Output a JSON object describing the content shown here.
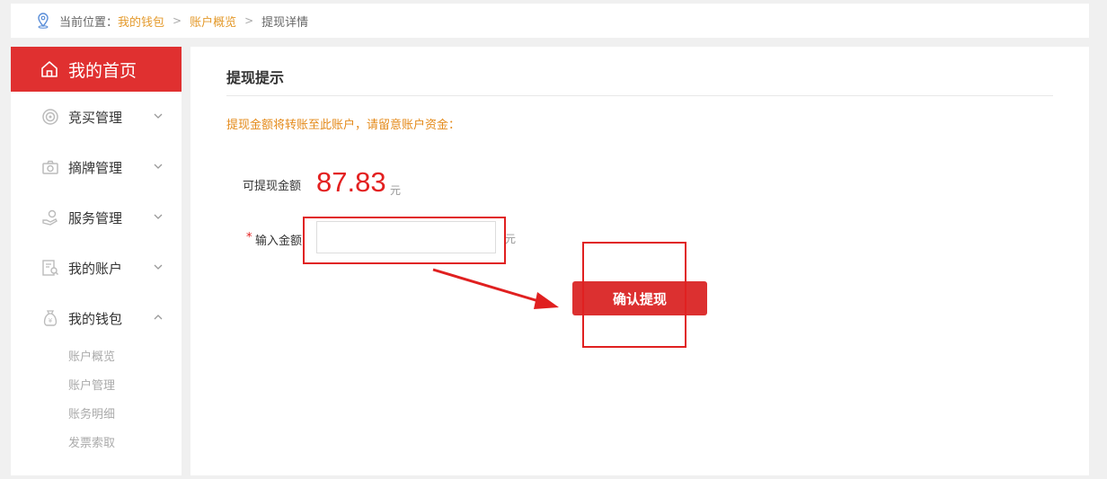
{
  "breadcrumb": {
    "prefix": "当前位置：",
    "items": [
      "我的钱包",
      "账户概览"
    ],
    "current": "提现详情"
  },
  "sidebar": {
    "home_label": "我的首页",
    "items": [
      {
        "label": "竞买管理",
        "icon": "target-icon",
        "expanded": false
      },
      {
        "label": "摘牌管理",
        "icon": "camera-icon",
        "expanded": false
      },
      {
        "label": "服务管理",
        "icon": "hand-icon",
        "expanded": false
      },
      {
        "label": "我的账户",
        "icon": "account-icon",
        "expanded": false
      },
      {
        "label": "我的钱包",
        "icon": "money-bag-icon",
        "expanded": true
      }
    ],
    "wallet_subitems": [
      "账户概览",
      "账户管理",
      "账务明细",
      "发票索取"
    ]
  },
  "main": {
    "section_title": "提现提示",
    "notice": "提现金额将转账至此账户，请留意账户资金：",
    "balance_label": "可提现金额",
    "balance_value": "87.83",
    "balance_unit": "元",
    "required_mark": "*",
    "amount_label": "输入金额",
    "amount_value": "",
    "amount_unit": "元",
    "confirm_label": "确认提现"
  },
  "colors": {
    "accent": "#e03030",
    "link": "#e49a2c",
    "notice": "#e48a1a",
    "balance": "#e32020"
  }
}
